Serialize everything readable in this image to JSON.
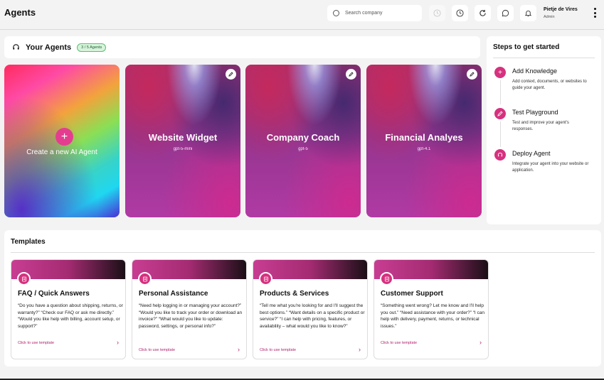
{
  "header": {
    "title": "Agents",
    "search_placeholder": "Search company",
    "user_name": "Pietje de Vires",
    "user_role": "Admin"
  },
  "agents_section": {
    "title": "Your Agents",
    "badge": "3 / 5 Agents",
    "create_label": "Create a new AI Agent",
    "create_plus": "+",
    "agents": [
      {
        "name": "Website Widget",
        "model": "gpt-5-mini"
      },
      {
        "name": "Company Coach",
        "model": "gpt-5"
      },
      {
        "name": "Financial Analyes",
        "model": "gpt-4.1"
      }
    ]
  },
  "steps": {
    "title": "Steps to get started",
    "items": [
      {
        "name": "Add Knowledge",
        "desc": "Add context, documents, or websites to guide your agent."
      },
      {
        "name": "Test Playground",
        "desc": "Test and improve your agent's responses."
      },
      {
        "name": "Deploy Agent",
        "desc": "Integrate your agent into your website or application."
      }
    ]
  },
  "templates": {
    "title": "Templates",
    "items": [
      {
        "title": "FAQ / Quick Answers",
        "desc": "“Do you have a question about shipping, returns, or warranty?” “Check our FAQ or ask me directly.” “Would you like help with billing, account setup, or support?”",
        "link": "Click to use template",
        "chevron": "›"
      },
      {
        "title": "Personal Assistance",
        "desc": "“Need help logging in or managing your account?” “Would you like to track your order or download an invoice?” “What would you like to update: password, settings, or personal info?”",
        "link": "Click to use template",
        "chevron": "›"
      },
      {
        "title": "Products & Services",
        "desc": "“Tell me what you're looking for and I'll suggest the best options.” “Want details on a specific product or service?” “I can help with pricing, features, or availability – what would you like to know?”",
        "link": "Click to use template",
        "chevron": "›"
      },
      {
        "title": "Customer Support",
        "desc": "“Something went wrong? Let me know and I'll help you out.” “Need assistance with your order?” “I can help with delivery, payment, returns, or technical issues.”",
        "link": "Click to use template",
        "chevron": "›"
      }
    ]
  },
  "colors": {
    "accent": "#d6317f",
    "link": "#b0216e",
    "badge_bg": "#d8f3dc"
  },
  "icons": [
    "search-icon",
    "clock-faded-icon",
    "clock-icon",
    "refresh-icon",
    "chat-icon",
    "bell-icon",
    "kebab-icon",
    "headset-icon",
    "pencil-icon",
    "plus-icon",
    "document-icon"
  ]
}
